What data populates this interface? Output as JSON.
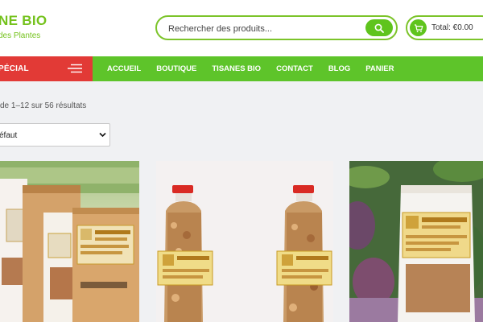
{
  "header": {
    "logo_title": "NE BIO",
    "logo_subtitle": "des Plantes",
    "search_placeholder": "Rechercher des produits...",
    "cart_total": "Total: €0.00"
  },
  "nav": {
    "special_label": "PÉCIAL",
    "items": [
      "ACCUEIL",
      "BOUTIQUE",
      "TISANES BIO",
      "CONTACT",
      "BLOG",
      "PANIER"
    ]
  },
  "shop": {
    "result_count": "de 1–12 sur 56 résultats",
    "sort_selected": "éfaut"
  },
  "colors": {
    "brand_green": "#5ec42a",
    "special_red": "#e23a36",
    "background": "#f0f1f3"
  },
  "icons": {
    "search": "search-icon",
    "cart": "cart-icon",
    "menu": "menu-icon",
    "dropdown": "chevron-down-icon"
  }
}
